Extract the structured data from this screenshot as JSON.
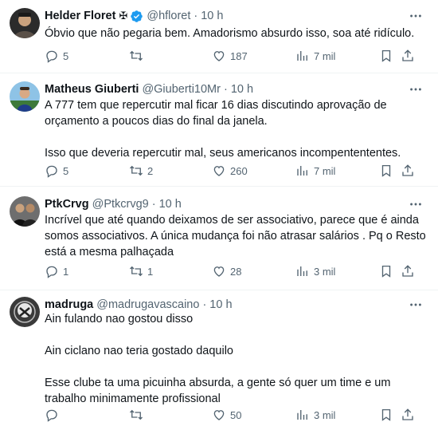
{
  "tweets": [
    {
      "author": {
        "name": "Helder Floret",
        "badge": "✠",
        "verified": true,
        "handle": "@hfloret"
      },
      "time": "10 h",
      "paragraphs": [
        "Óbvio que não pegaria bem. Amadorismo absurdo isso, soa até ridículo."
      ],
      "stats": {
        "replies": "5",
        "retweets": "",
        "likes": "187",
        "views": "7 mil"
      }
    },
    {
      "author": {
        "name": "Matheus Giuberti",
        "handle": "@Giuberti10Mr"
      },
      "time": "10 h",
      "paragraphs": [
        "A 777 tem que repercutir mal ficar 16 dias discutindo aprovação de orçamento a poucos dias do final da janela.",
        "Isso que deveria repercutir mal, seus americanos incompentententes."
      ],
      "stats": {
        "replies": "5",
        "retweets": "2",
        "likes": "260",
        "views": "7 mil"
      }
    },
    {
      "author": {
        "name": "PtkCrvg",
        "handle": "@Ptkcrvg9"
      },
      "time": "10 h",
      "paragraphs": [
        "Incrível que até quando deixamos de ser associativo, parece que é ainda somos associativos. A única mudança foi não atrasar salários . Pq o Resto está a mesma palhaçada"
      ],
      "stats": {
        "replies": "1",
        "retweets": "1",
        "likes": "28",
        "views": "3 mil"
      }
    },
    {
      "author": {
        "name": "madruga",
        "handle": "@madrugavascaino"
      },
      "time": "10 h",
      "paragraphs": [
        "Ain fulando nao gostou disso",
        "Ain ciclano nao teria gostado daquilo",
        "Esse clube ta uma picuinha absurda, a gente só quer um time e um trabalho minimamente profissional"
      ],
      "stats": {
        "replies": "",
        "retweets": "",
        "likes": "50",
        "views": "3 mil"
      }
    }
  ],
  "icons": {
    "reply": "reply-icon",
    "retweet": "retweet-icon",
    "like": "heart-icon",
    "views": "views-icon",
    "bookmark": "bookmark-icon",
    "share": "share-icon",
    "more": "more-icon",
    "verified": "verified-badge-icon"
  },
  "colors": {
    "text": "#0f1419",
    "secondary": "#536471",
    "verified": "#1d9bf0",
    "divider": "#eff3f4"
  }
}
